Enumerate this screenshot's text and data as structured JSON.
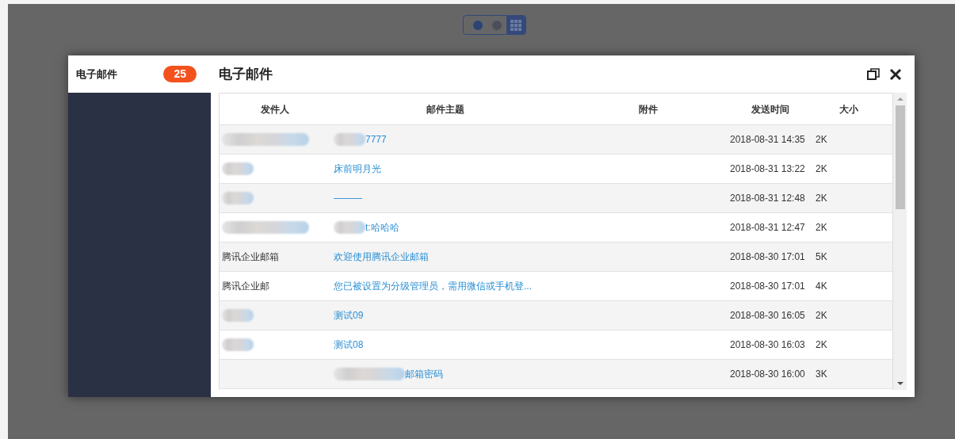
{
  "view_toggle": [
    {
      "kind": "dot",
      "selected": true
    },
    {
      "kind": "dot",
      "selected": false
    },
    {
      "kind": "grid",
      "selected": true
    }
  ],
  "sidebar": {
    "title": "电子邮件",
    "badge": "25"
  },
  "dialog": {
    "title": "电子邮件"
  },
  "table": {
    "columns": [
      "发件人",
      "邮件主题",
      "附件",
      "发送时间",
      "大小"
    ],
    "rows": [
      {
        "sender": "",
        "sender_blurred": true,
        "subject": "7777",
        "subject_blurred": true,
        "time": "2018-08-31 14:35",
        "size": "2K"
      },
      {
        "sender": "",
        "sender_blurred": true,
        "subject": "床前明月光",
        "subject_blurred": false,
        "time": "2018-08-31 13:22",
        "size": "2K"
      },
      {
        "sender": "",
        "sender_blurred": true,
        "subject": "———",
        "subject_blurred": false,
        "time": "2018-08-31 12:48",
        "size": "2K"
      },
      {
        "sender": "",
        "sender_blurred": true,
        "subject": "t:哈哈哈",
        "subject_blurred": true,
        "time": "2018-08-31 12:47",
        "size": "2K"
      },
      {
        "sender": "腾讯企业邮箱",
        "sender_blurred": false,
        "subject": "欢迎使用腾讯企业邮箱",
        "subject_blurred": false,
        "time": "2018-08-30 17:01",
        "size": "5K"
      },
      {
        "sender": "腾讯企业邮",
        "sender_blurred": false,
        "subject": "您已被设置为分级管理员，需用微信或手机登...",
        "subject_blurred": false,
        "time": "2018-08-30 17:01",
        "size": "4K"
      },
      {
        "sender": "",
        "sender_blurred": true,
        "subject": "测试09",
        "subject_blurred": false,
        "time": "2018-08-30 16:05",
        "size": "2K"
      },
      {
        "sender": "",
        "sender_blurred": true,
        "subject": "测试08",
        "subject_blurred": false,
        "time": "2018-08-30 16:03",
        "size": "2K"
      },
      {
        "sender": "",
        "sender_blurred": false,
        "subject": "邮箱密码",
        "subject_blurred": true,
        "time": "2018-08-30 16:00",
        "size": "3K"
      }
    ]
  }
}
